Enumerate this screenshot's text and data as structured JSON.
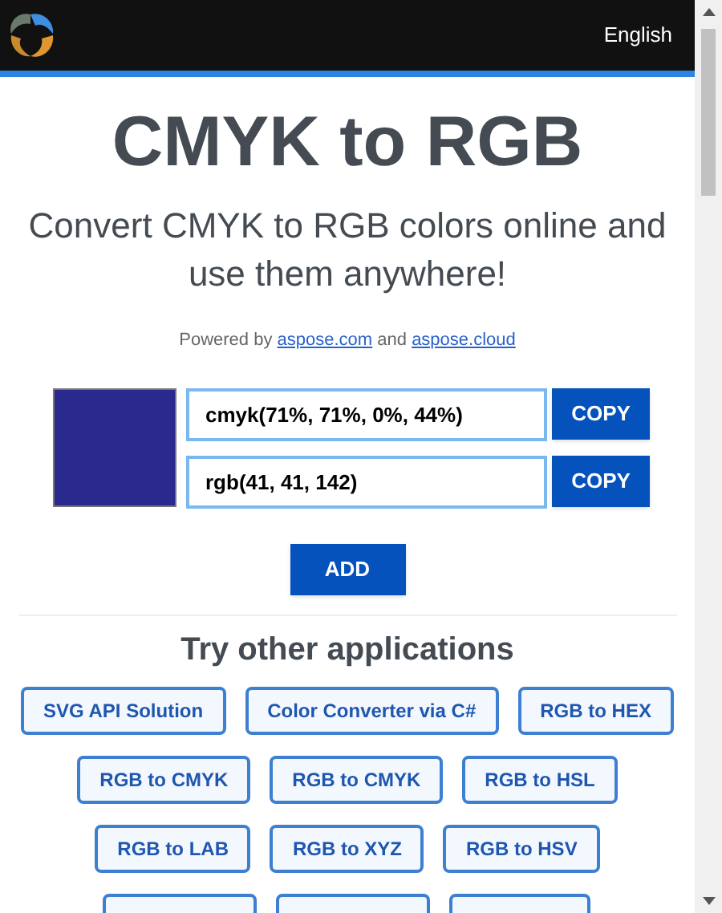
{
  "header": {
    "language": "English"
  },
  "title": "CMYK to RGB",
  "subtitle": "Convert CMYK to RGB colors online and use them anywhere!",
  "powered_by": {
    "prefix": "Powered by",
    "link1": "aspose.com",
    "joiner": "and",
    "link2": "aspose.cloud"
  },
  "converter": {
    "color": "#29298e",
    "fields": [
      {
        "value": "cmyk(71%, 71%, 0%, 44%)",
        "button": "COPY"
      },
      {
        "value": "rgb(41, 41, 142)",
        "button": "COPY"
      }
    ],
    "add_button": "ADD"
  },
  "apps": {
    "heading": "Try other applications",
    "rows": [
      [
        "SVG API Solution",
        "Color Converter via C#",
        "RGB to HEX"
      ],
      [
        "RGB to CMYK",
        "RGB to CMYK",
        "RGB to HSL"
      ],
      [
        "RGB to LAB",
        "RGB to XYZ",
        "RGB to HSV"
      ]
    ]
  }
}
